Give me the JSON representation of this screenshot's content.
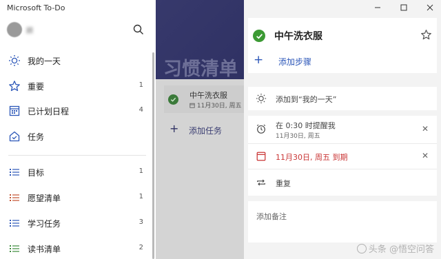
{
  "window": {
    "app_title": "Microsoft To-Do"
  },
  "sidebar": {
    "user_name": "顾          ",
    "items": [
      {
        "label": "我的一天",
        "count": "",
        "icon": "sun-icon",
        "color": "#2b56b8"
      },
      {
        "label": "重要",
        "count": "1",
        "icon": "star-icon",
        "color": "#2b56b8"
      },
      {
        "label": "已计划日程",
        "count": "4",
        "icon": "calendar-icon",
        "color": "#2b56b8"
      },
      {
        "label": "任务",
        "count": "",
        "icon": "home-icon",
        "color": "#2b56b8"
      },
      {
        "label": "目标",
        "count": "1",
        "icon": "list-icon",
        "color": "#2b56b8"
      },
      {
        "label": "愿望清单",
        "count": "1",
        "icon": "list-icon",
        "color": "#c3512f"
      },
      {
        "label": "学习任务",
        "count": "3",
        "icon": "list-icon",
        "color": "#2b56b8"
      },
      {
        "label": "读书清单",
        "count": "2",
        "icon": "list-icon",
        "color": "#3b8a3a"
      }
    ]
  },
  "middle": {
    "list_title": "习惯清单",
    "task": {
      "title": "中午洗衣服",
      "subtitle": "11月30日, 周五"
    },
    "add_task_label": "添加任务"
  },
  "detail": {
    "task_title": "中午洗衣服",
    "add_step_label": "添加步骤",
    "add_to_my_day": "添加到“我的一天”",
    "reminder": {
      "text": "在 0:30 时提醒我",
      "sub": "11月30日, 周五"
    },
    "due": {
      "text": "11月30日, 周五 到期",
      "color": "#c93434"
    },
    "repeat_label": "重复",
    "note_placeholder": "添加备注"
  },
  "colors": {
    "accent": "#2b56b8",
    "complete": "#3c9a34",
    "banner": "#37396c"
  },
  "watermark": "头条 @悟空问答"
}
